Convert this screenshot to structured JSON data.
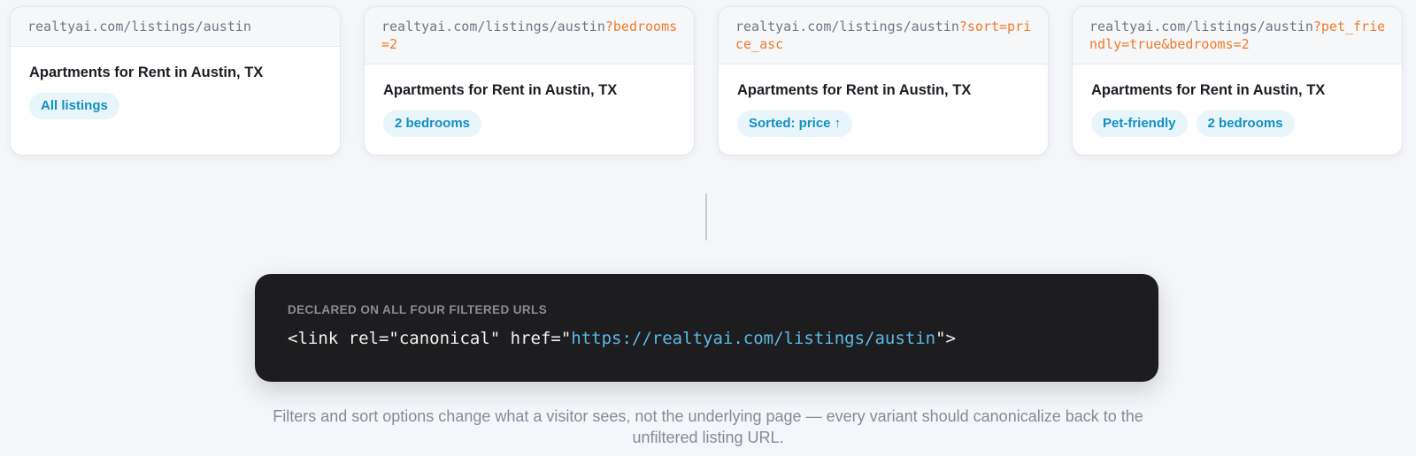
{
  "cards": [
    {
      "url_base": "realtyai.com/listings/austin",
      "url_query": "",
      "title": "Apartments for Rent in Austin, TX",
      "tags": [
        "All listings"
      ]
    },
    {
      "url_base": "realtyai.com/listings/austin",
      "url_query": "?bedrooms=2",
      "title": "Apartments for Rent in Austin, TX",
      "tags": [
        "2 bedrooms"
      ]
    },
    {
      "url_base": "realtyai.com/listings/austin",
      "url_query": "?sort=price_asc",
      "title": "Apartments for Rent in Austin, TX",
      "tags": [
        "Sorted: price ↑"
      ]
    },
    {
      "url_base": "realtyai.com/listings/austin",
      "url_query": "?pet_friendly=true&bedrooms=2",
      "title": "Apartments for Rent in Austin, TX",
      "tags": [
        "Pet-friendly",
        "2 bedrooms"
      ]
    }
  ],
  "code": {
    "label": "DECLARED ON ALL FOUR FILTERED URLS",
    "prefix": "<link rel=\"canonical\" href=\"",
    "href": "https://realtyai.com/listings/austin",
    "suffix": "\">"
  },
  "caption": "Filters and sort options change what a visitor sees, not the underlying page — every variant should canonicalize back to the unfiltered listing URL.",
  "colors": {
    "query_accent": "#ef7a2c",
    "tag_text": "#1390c0",
    "tag_bg": "#e8f5fb",
    "code_bg": "#1d1d1f",
    "code_href": "#5ab9e8"
  }
}
